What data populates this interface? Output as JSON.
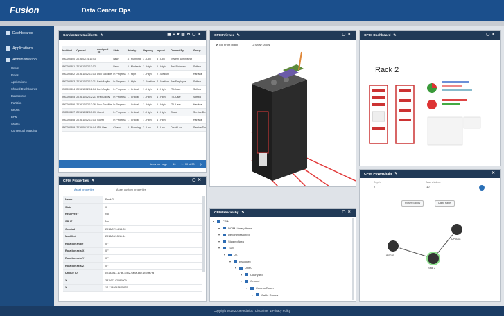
{
  "app": {
    "logo": "Fusion",
    "title": "Data Center Ops"
  },
  "sidebar": {
    "items": [
      {
        "label": "Dashboards"
      },
      {
        "label": "Applications"
      },
      {
        "label": "Administration"
      }
    ],
    "subitems": [
      "Users",
      "Roles",
      "Applications",
      "Shared Dashboards",
      "Datasource",
      "Partition",
      "Report",
      "BPM",
      "Assets",
      "Contextual Mapping"
    ]
  },
  "incidents": {
    "title": "ServiceNow Incidents",
    "columns": [
      "Incident",
      "Opened",
      "Assigned To",
      "State",
      "Priority",
      "Urgency",
      "Impact",
      "Opened By",
      "Group"
    ],
    "rows": [
      [
        "INC000300",
        "2016/02/14 11:43",
        "",
        "New",
        "4 - Planning",
        "3 - Low",
        "3 - Low",
        "System Administrat",
        ""
      ],
      [
        "INC000301",
        "2016/11/12 13:12",
        "",
        "New",
        "3 - Moderate",
        "1 - High",
        "1 - High",
        "Bud Richman",
        "Softwa"
      ],
      [
        "INC000302",
        "2016/11/12 13:13",
        "Don Goodlife",
        "In Progress",
        "2 - High",
        "1 - High",
        "2 - Medium",
        "",
        "Hardwa"
      ],
      [
        "INC000303",
        "2016/11/12 13:21",
        "Beth Anglin",
        "In Progress",
        "2 - High",
        "2 - Medium",
        "2 - Medium",
        "Joe Employee",
        "Softwa"
      ],
      [
        "INC000304",
        "2016/11/12 12:14",
        "Beth Anglin",
        "In Progress",
        "1 - Critical",
        "1 - High",
        "1 - High",
        "ITIL User",
        "Softwa"
      ],
      [
        "INC000305",
        "2016/11/12 12:21",
        "Fred Luddy",
        "In Progress",
        "1 - Critical",
        "1 - High",
        "1 - High",
        "ITIL User",
        "Softwa"
      ],
      [
        "INC000306",
        "2016/11/12 12:36",
        "Don Goodlife",
        "In Progress",
        "1 - Critical",
        "1 - High",
        "1 - High",
        "ITIL User",
        "Hardwa"
      ],
      [
        "INC000307",
        "2016/11/12 13:09",
        "Guest",
        "In Progress",
        "1 - Critical",
        "1 - High",
        "1 - High",
        "Guest",
        "Service Desk"
      ],
      [
        "INC000308",
        "2016/11/12 13:13",
        "Guest",
        "In Progress",
        "1 - Critical",
        "1 - High",
        "1 - High",
        "",
        "Hardwa"
      ],
      [
        "INC000309",
        "2016/08/10 16:04",
        "ITIL User",
        "Closed",
        "4 - Planning",
        "3 - Low",
        "3 - Low",
        "David Loo",
        "Service Desk"
      ]
    ],
    "pager": {
      "items_label": "Items per page",
      "per_page": "10",
      "range": "1 - 10 of 30"
    }
  },
  "properties": {
    "title": "CPIM Properties",
    "tabs": [
      "Asset properties",
      "Asset custom properties"
    ],
    "rows": [
      [
        "Name",
        "Rack 2"
      ],
      [
        "State",
        "0"
      ],
      [
        "Reserved?",
        "No"
      ],
      [
        "SBUT",
        "No"
      ],
      [
        "Created",
        "2016/07/14 15:39"
      ],
      [
        "Modified",
        "2016/06/15 11:34"
      ],
      [
        "Rotation angle",
        "0 °"
      ],
      [
        "Rotation axis X",
        "0 °"
      ],
      [
        "Rotation axis Y",
        "0 °"
      ],
      [
        "Rotation axis Z",
        "0 °"
      ],
      [
        "Unique ID",
        "c0192811-17ab-4d52-9aba-8621b4bfe7fa"
      ],
      [
        "X",
        "381.67142080009"
      ],
      [
        "Y",
        "12.1148641645625"
      ]
    ]
  },
  "viewer": {
    "title": "CPIM Viewer",
    "view_label": "Top Front Right",
    "show_doors": "Show Doors"
  },
  "hierarchy": {
    "title": "CPIM Hierarchy",
    "nodes": [
      "CPIM",
      "DCIM Library Items",
      "Decommissioned",
      "Staging Area",
      "TDM",
      "UK",
      "Bracknell",
      "Unit C",
      "Courtyard",
      "Ground",
      "Comms Room",
      "Cable Routes"
    ]
  },
  "dashboard": {
    "title": "CPIM Dashboard",
    "rack_label": "Rack 2"
  },
  "powerchain": {
    "title": "CPIM Powerchain",
    "depth_label": "Depth",
    "depth_value": "2",
    "max_children_label": "Max children",
    "max_children_value": "10",
    "chips": [
      "Power Supply",
      "Utility Panel"
    ],
    "nodes": [
      "UPS02B",
      "UPS02a",
      "Rack 2"
    ]
  },
  "footer": {
    "text": "Copyright 2018-2019 Fedarius | Disclaimer & Privacy Policy"
  }
}
